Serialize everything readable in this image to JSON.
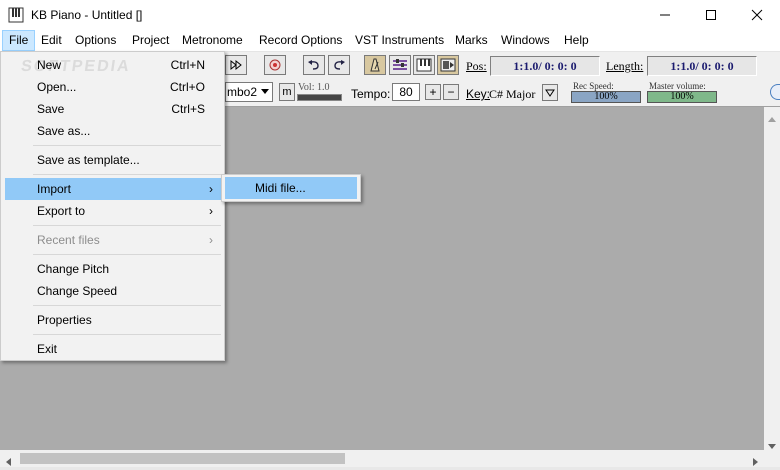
{
  "window": {
    "title": "KB Piano - Untitled []"
  },
  "menubar": [
    "File",
    "Edit",
    "Options",
    "Project",
    "Metronome",
    "Record Options",
    "VST Instruments",
    "Marks",
    "Windows",
    "Help"
  ],
  "toolbar": {
    "combo_value": "mbo2",
    "m_button": "m",
    "vol_label": "Vol: 1.0",
    "tempo_label": "Tempo:",
    "tempo_value": "80",
    "plus": "+",
    "minus": "−",
    "key_label": "Key:",
    "key_value": "C# Major",
    "pos_label": "Pos:",
    "pos_value": "1:1.0/ 0: 0: 0",
    "length_label": "Length:",
    "length_value": "1:1.0/ 0: 0: 0",
    "rec_speed_label": "Rec Speed:",
    "rec_speed_value": "100%",
    "master_volume_label": "Master volume:",
    "master_volume_value": "100%"
  },
  "file_menu": {
    "items": [
      {
        "label": "New",
        "shortcut": "Ctrl+N"
      },
      {
        "label": "Open...",
        "shortcut": "Ctrl+O"
      },
      {
        "label": "Save",
        "shortcut": "Ctrl+S"
      },
      {
        "label": "Save as...",
        "shortcut": ""
      },
      {
        "label": "Save as template...",
        "shortcut": ""
      },
      {
        "label": "Import",
        "shortcut": "",
        "submenu": true
      },
      {
        "label": "Export to",
        "shortcut": "",
        "submenu": true
      },
      {
        "label": "Recent files",
        "shortcut": "",
        "submenu": true,
        "disabled": true
      },
      {
        "label": "Change Pitch",
        "shortcut": ""
      },
      {
        "label": "Change Speed",
        "shortcut": ""
      },
      {
        "label": "Properties",
        "shortcut": ""
      },
      {
        "label": "Exit",
        "shortcut": ""
      }
    ],
    "arrow": "›"
  },
  "import_submenu": {
    "items": [
      {
        "label": "Midi file..."
      }
    ]
  },
  "watermark": "SOFTPEDIA",
  "colors": {
    "highlight": "#91c9f7",
    "workarea": "#ababab",
    "menu_active": "#cce8ff",
    "pos_text": "#1a1a6e"
  }
}
